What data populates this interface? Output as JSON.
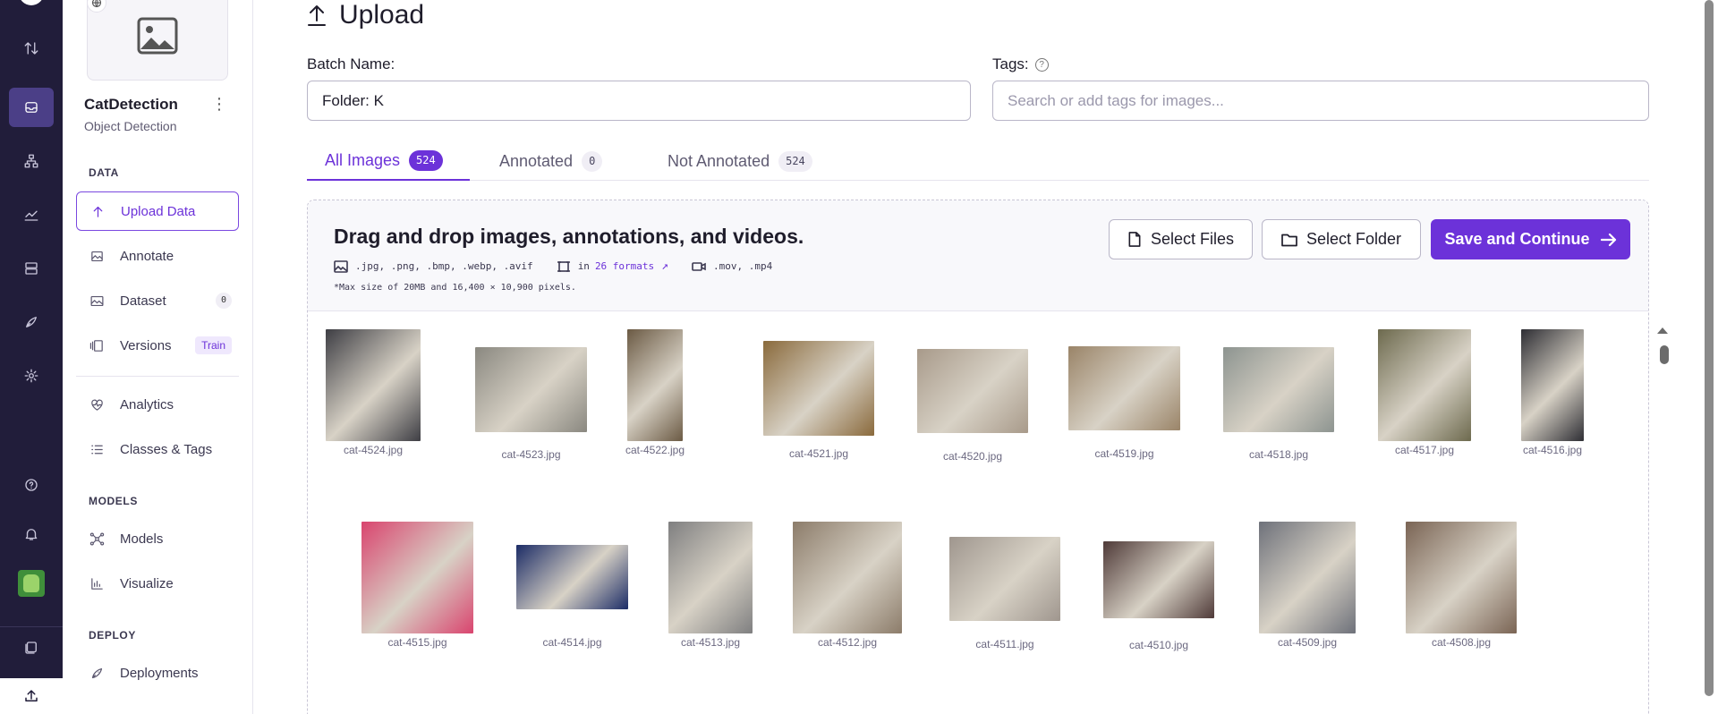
{
  "rail": {
    "items": [
      {
        "name": "rail-transfer-icon"
      },
      {
        "name": "rail-projects-icon"
      },
      {
        "name": "rail-workflows-icon"
      },
      {
        "name": "rail-analytics-icon"
      },
      {
        "name": "rail-storage-icon"
      },
      {
        "name": "rail-deploy-icon"
      },
      {
        "name": "rail-settings-icon"
      }
    ]
  },
  "project": {
    "name": "CatDetection",
    "type": "Object Detection"
  },
  "sidebar": {
    "section_data": "DATA",
    "section_models": "MODELS",
    "section_deploy": "DEPLOY",
    "upload_data": "Upload Data",
    "annotate": "Annotate",
    "dataset": "Dataset",
    "dataset_count": "0",
    "versions": "Versions",
    "versions_badge": "Train",
    "analytics": "Analytics",
    "classes_tags": "Classes & Tags",
    "models": "Models",
    "visualize": "Visualize",
    "deployments": "Deployments"
  },
  "page": {
    "title": "Upload"
  },
  "form": {
    "batch_label": "Batch Name:",
    "batch_value": "Folder: K",
    "tags_label": "Tags:",
    "tags_placeholder": "Search or add tags for images..."
  },
  "tabs": [
    {
      "label": "All Images",
      "count": "524"
    },
    {
      "label": "Annotated",
      "count": "0"
    },
    {
      "label": "Not Annotated",
      "count": "524"
    }
  ],
  "dropzone": {
    "title": "Drag and drop images, annotations, and videos.",
    "image_formats": ".jpg, .png, .bmp, .webp, .avif",
    "annotation_prefix": "in",
    "annotation_link": "26 formats",
    "video_formats": ".mov, .mp4",
    "note": "*Max size of 20MB and 16,400 × 10,900 pixels.",
    "select_files": "Select Files",
    "select_folder": "Select Folder",
    "save_continue": "Save and Continue"
  },
  "images": [
    {
      "name": "cat-4524.jpg",
      "color": "#3e3e44"
    },
    {
      "name": "cat-4523.jpg",
      "color": "#8a8880"
    },
    {
      "name": "cat-4522.jpg",
      "color": "#6b5a44"
    },
    {
      "name": "cat-4521.jpg",
      "color": "#8a6a3c"
    },
    {
      "name": "cat-4520.jpg",
      "color": "#a89a8a"
    },
    {
      "name": "cat-4519.jpg",
      "color": "#9a8468"
    },
    {
      "name": "cat-4518.jpg",
      "color": "#8d9490"
    },
    {
      "name": "cat-4517.jpg",
      "color": "#6d6a4e"
    },
    {
      "name": "cat-4516.jpg",
      "color": "#2e2e34"
    },
    {
      "name": "cat-4515.jpg",
      "color": "#d9446e"
    },
    {
      "name": "cat-4514.jpg",
      "color": "#1c2c66"
    },
    {
      "name": "cat-4513.jpg",
      "color": "#7f7f80"
    },
    {
      "name": "cat-4512.jpg",
      "color": "#8c7c6a"
    },
    {
      "name": "cat-4511.jpg",
      "color": "#9f968e"
    },
    {
      "name": "cat-4510.jpg",
      "color": "#4f3a38"
    },
    {
      "name": "cat-4509.jpg",
      "color": "#6e717a"
    },
    {
      "name": "cat-4508.jpg",
      "color": "#7a6454"
    }
  ],
  "colors": {
    "rail_bg": "#211d3a",
    "accent": "#6c32d9"
  }
}
